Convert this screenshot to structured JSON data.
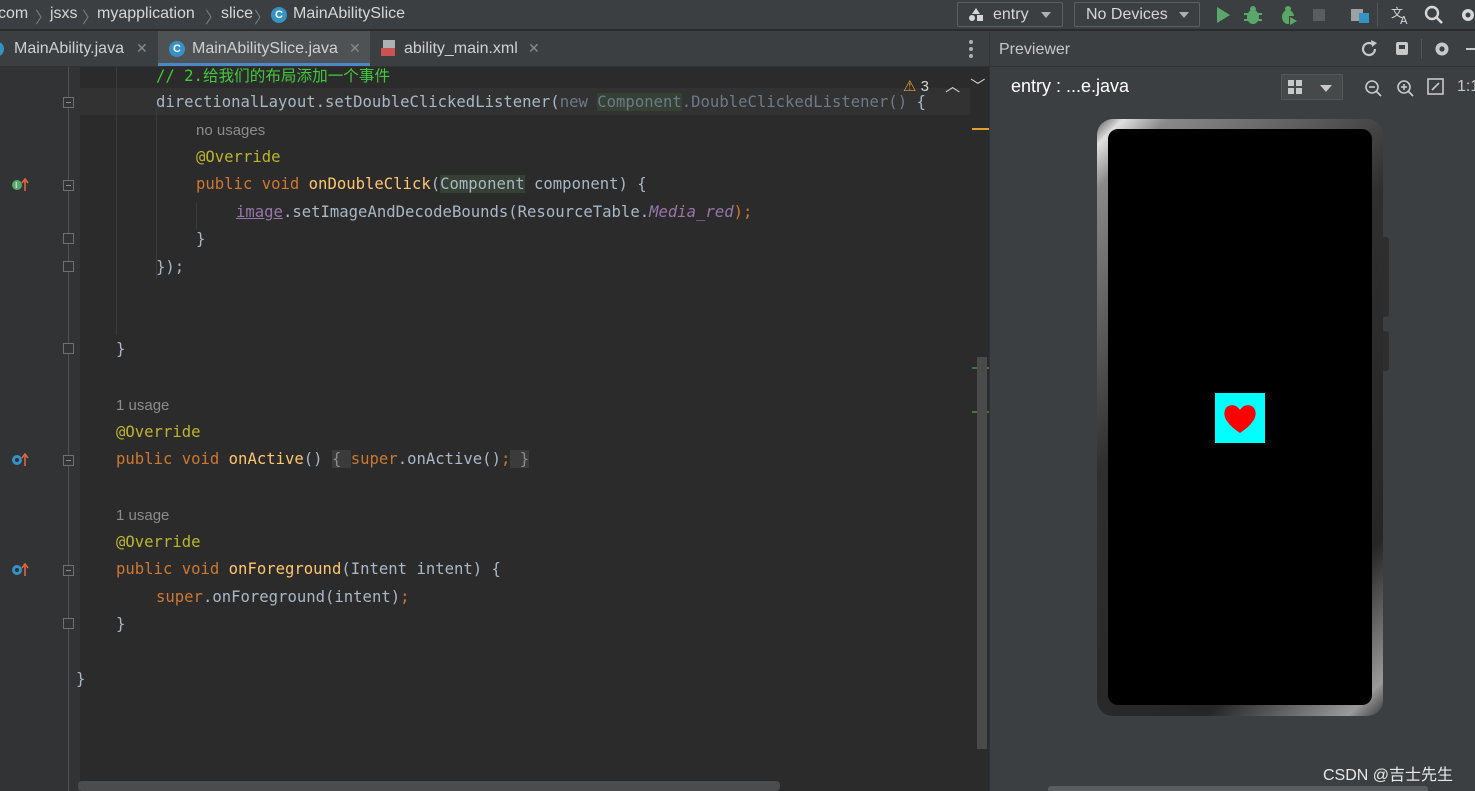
{
  "breadcrumbs": {
    "items": [
      "com",
      "jsxs",
      "myapplication",
      "slice",
      "MainAbilitySlice"
    ]
  },
  "toolbar": {
    "module_combo": "entry",
    "device_combo": "No Devices"
  },
  "tabs": {
    "items": [
      {
        "label": "MainAbility.java",
        "active": false
      },
      {
        "label": "MainAbilitySlice.java",
        "active": true
      },
      {
        "label": "ability_main.xml",
        "active": false
      }
    ]
  },
  "editor": {
    "warning_count": "3",
    "code": {
      "l1": "// 2.给我们的布局添加一个事件",
      "l2_a": "directionalLayout.setDoubleClickedListener(",
      "l2_b": "new ",
      "l2_c": "Component",
      "l2_d": ".DoubleClickedListener()",
      "l2_e": " {",
      "hint_no_usages": "no usages",
      "l3": "@Override",
      "l4_a": "public void ",
      "l4_b": "onDoubleClick",
      "l4_c": "(",
      "l4_d": "Component",
      "l4_e": " component) {",
      "l5_a": "image",
      "l5_b": ".setImageAndDecodeBounds(ResourceTable.",
      "l5_c": "Media_red",
      "l5_d": ");",
      "l6": "}",
      "l7_a": "});",
      "l8": "}",
      "hint_usage_1": "1 usage",
      "l9": "@Override",
      "l10_a": "public void ",
      "l10_b": "onActive",
      "l10_c": "() ",
      "l10_d": "{ ",
      "l10_e": "super",
      "l10_f": ".onActive()",
      "l10_g": ";",
      "l10_h": " }",
      "hint_usage_2": "1 usage",
      "l11": "@Override",
      "l12_a": "public void ",
      "l12_b": "onForeground",
      "l12_c": "(Intent intent) {",
      "l13_a": "super",
      "l13_b": ".onForeground(intent)",
      "l13_c": ";",
      "l14": "}",
      "l15": "}"
    }
  },
  "previewer": {
    "title": "Previewer",
    "entry_label": "entry : ...e.java",
    "zoom_label": "1:1",
    "watermark": "CSDN @吉士先生"
  },
  "colors": {
    "keyword": "#cc7832",
    "function": "#ffc66d",
    "annotation": "#bbb529",
    "comment": "#41c83c",
    "static_field": "#9876aa",
    "preview_box": "#00ffff",
    "heart": "#ff0000"
  },
  "icons": [
    "module-icon",
    "run-icon",
    "debug-icon",
    "profile-icon",
    "stop-icon",
    "project-structure-icon",
    "translate-icon",
    "search-icon",
    "refresh-icon",
    "inspect-icon",
    "settings-icon",
    "minimize-icon",
    "grid-icon",
    "zoom-out-icon",
    "zoom-in-icon",
    "fit-screen-icon",
    "heart-icon"
  ]
}
